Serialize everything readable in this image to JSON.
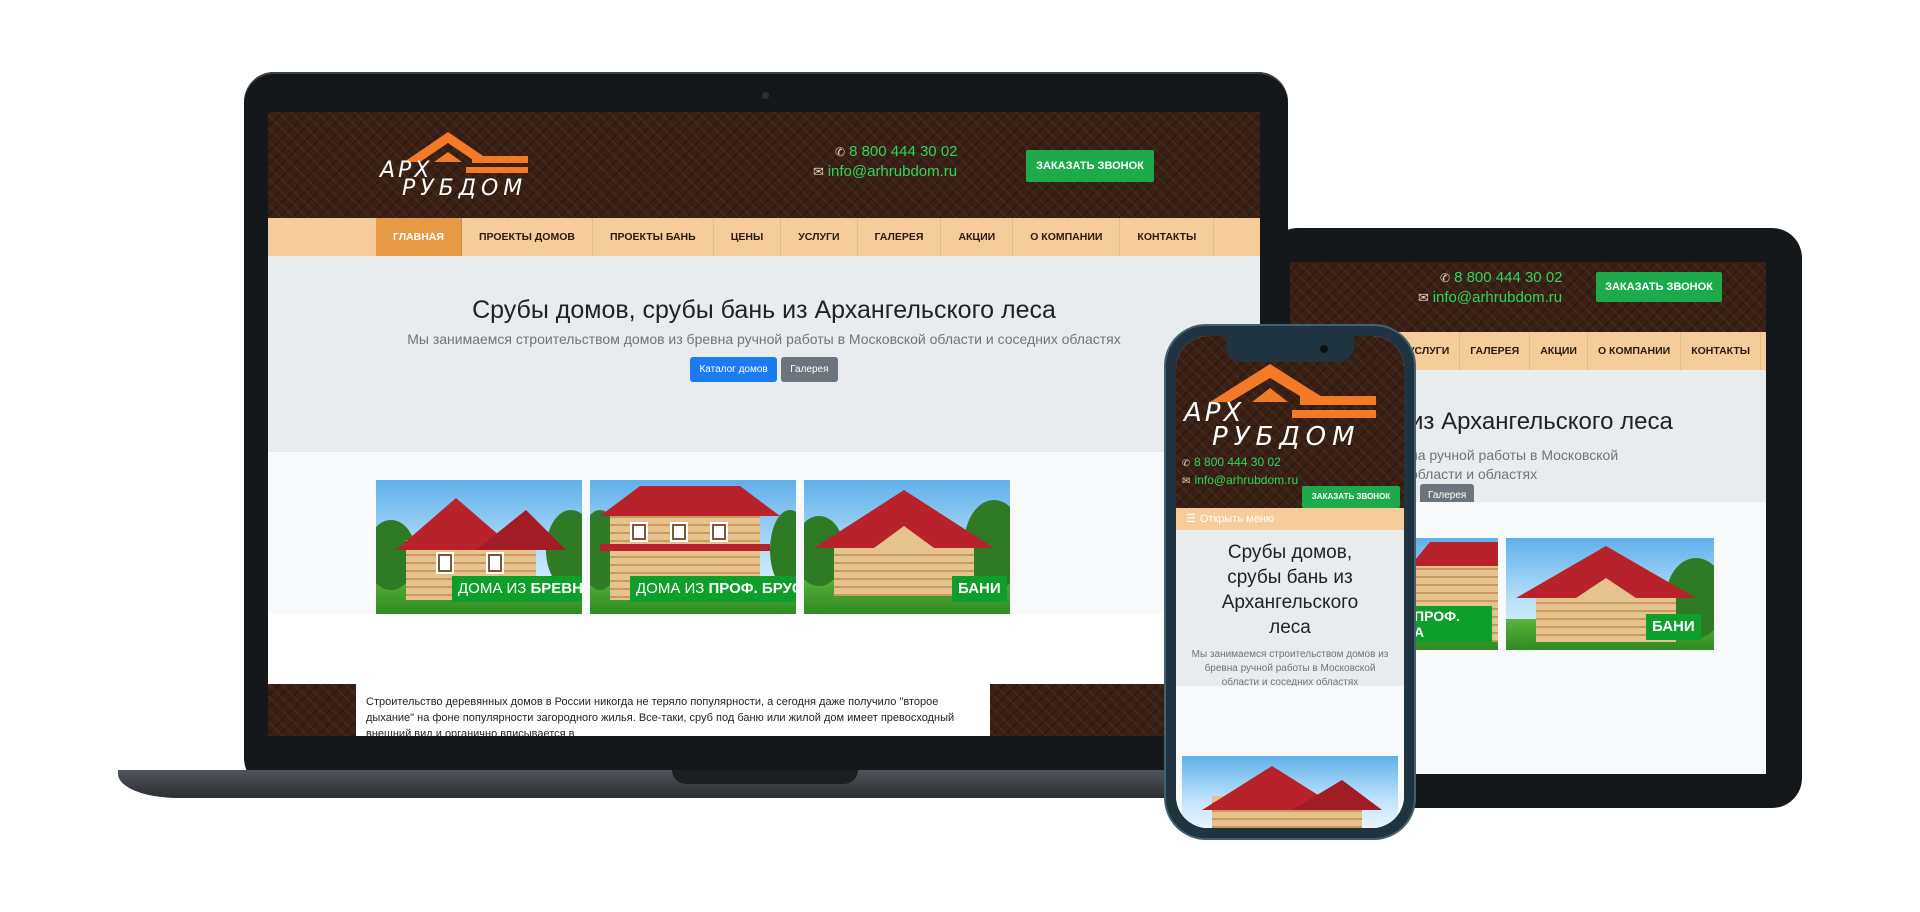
{
  "site": {
    "logo_top": "АРХ",
    "logo_bottom": "РУБДОМ",
    "phone": "8 800 444 30 02",
    "email": "info@arhrubdom.ru",
    "cta_label": "ЗАКАЗАТЬ ЗВОНОК",
    "nav": [
      "ГЛАВНАЯ",
      "ПРОЕКТЫ ДОМОВ",
      "ПРОЕКТЫ БАНЬ",
      "ЦЕНЫ",
      "УСЛУГИ",
      "ГАЛЕРЕЯ",
      "АКЦИИ",
      "О КОМПАНИИ",
      "КОНТАКТЫ"
    ],
    "hero_title": "Срубы домов, срубы бань из Архангельского леса",
    "hero_subtitle": "Мы занимаемся строительством домов из бревна ручной работы в Московской области и соседних областях",
    "btn_catalog": "Каталог домов",
    "btn_gallery": "Галерея",
    "cards": [
      {
        "label_pre": "ДОМА ИЗ ",
        "label_bold": "БРЕВНА"
      },
      {
        "label_pre": "ДОМА ИЗ ",
        "label_bold": "ПРОФ. БРУСА"
      },
      {
        "label_pre": "",
        "label_bold": "БАНИ"
      }
    ],
    "body_text": "Строительство деревянных  домов в России никогда не теряло популярности, а сегодня даже получило \"второе дыхание\" на фоне популярности загородного жилья. Все-таки, сруб под баню или жилой дом имеет превосходный внешний вид и органично вписывается в",
    "tablet_nav": [
      "УСЛУГИ",
      "ГАЛЕРЕЯ",
      "АКЦИИ",
      "О КОМПАНИИ",
      "КОНТАКТЫ"
    ],
    "tablet_hero_title": "из Архангельского леса",
    "tablet_hero_subtitle": "на ручной работы в Московской области и областях",
    "tablet_card_labels": [
      "ПРОФ.",
      "А",
      "БАНИ"
    ],
    "phone_menu": "Открыть меню",
    "phone_hero_title": "Срубы домов, срубы бань из Архангельского леса",
    "phone_hero_subtitle": "Мы занимаемся строительством домов из бревна ручной работы в Московской области и соседних областях"
  },
  "colors": {
    "header_wood": "#3a2014",
    "nav_bg": "#f6cc9a",
    "nav_active": "#e69a45",
    "cta_green": "#1daa4a",
    "contact_green": "#2fd65a",
    "label_green": "#0e9f2b",
    "btn_blue": "#1a7cf0",
    "btn_gray": "#6c757d",
    "logo_orange": "#f47a27"
  },
  "icons": [
    "phone-icon",
    "mail-icon",
    "hamburger-icon",
    "camera-icon"
  ]
}
